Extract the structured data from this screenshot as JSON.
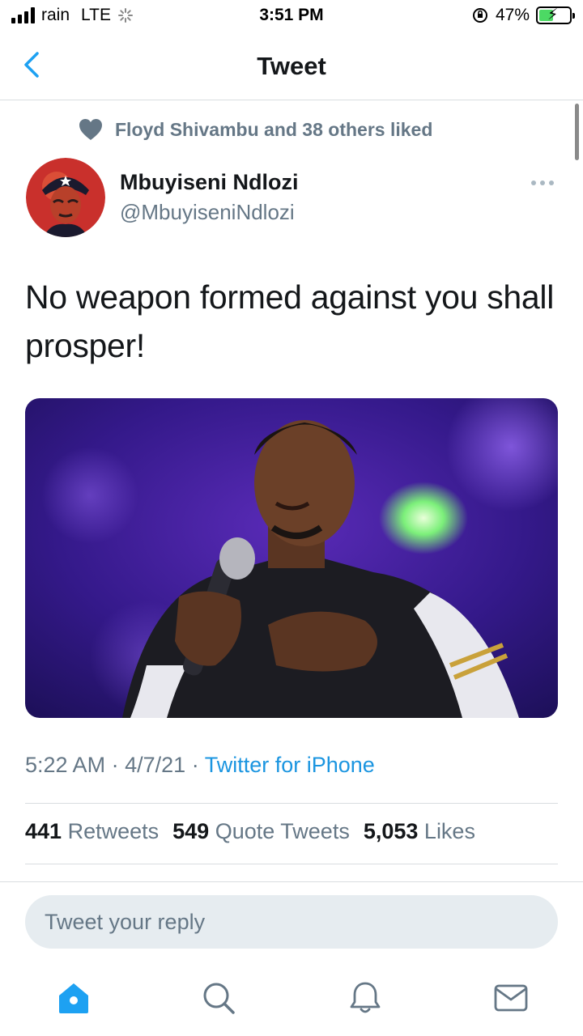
{
  "status_bar": {
    "carrier": "rain",
    "network": "LTE",
    "time": "3:51 PM",
    "battery_percent": "47%",
    "battery_level": 0.47
  },
  "nav": {
    "title": "Tweet"
  },
  "social_context": {
    "text": "Floyd Shivambu and 38 others liked"
  },
  "author": {
    "name": "Mbuyiseni Ndlozi",
    "handle": "@MbuyiseniNdlozi"
  },
  "tweet": {
    "text": "No weapon formed against you shall prosper!",
    "time": "5:22 AM",
    "date": "4/7/21",
    "source": "Twitter for iPhone",
    "separator": "·"
  },
  "stats": {
    "retweets_count": "441",
    "retweets_label": "Retweets",
    "quotes_count": "549",
    "quotes_label": "Quote Tweets",
    "likes_count": "5,053",
    "likes_label": "Likes"
  },
  "reply": {
    "placeholder": "Tweet your reply"
  },
  "tabs": [
    {
      "icon": "home-icon",
      "active": true
    },
    {
      "icon": "search-icon",
      "active": false
    },
    {
      "icon": "bell-icon",
      "active": false
    },
    {
      "icon": "mail-icon",
      "active": false
    }
  ],
  "colors": {
    "accent": "#1da1f2",
    "link": "#1b95e0",
    "secondary_text": "#657786"
  }
}
